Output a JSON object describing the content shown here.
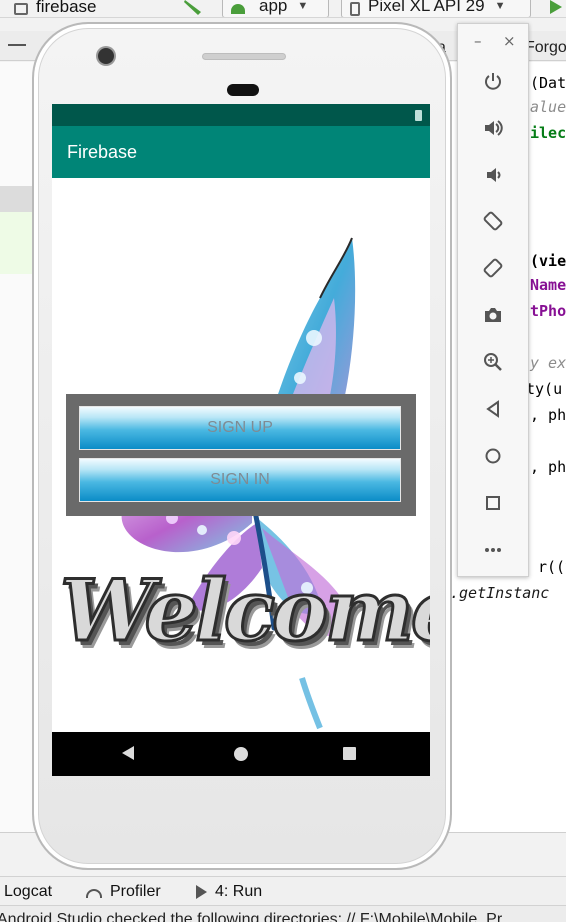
{
  "toolbar": {
    "project": "firebase",
    "run_config": "app",
    "device": "Pixel XL API 29"
  },
  "editor": {
    "tabs": [
      "va",
      "Forgo"
    ],
    "code_lines": [
      {
        "text": "(Dat",
        "style": "plain"
      },
      {
        "text": "alue",
        "style": "italic"
      },
      {
        "text": "ilec",
        "style": "green"
      },
      {
        "text": "(vie",
        "style": "bold"
      },
      {
        "text": "Name",
        "style": "purple"
      },
      {
        "text": "tPho",
        "style": "purple"
      },
      {
        "text": "y ex",
        "style": "italic"
      },
      {
        "text": "ty(u",
        "style": "plain"
      },
      {
        "text": ", ph",
        "style": "plain"
      },
      {
        "text": ", ph",
        "style": "plain"
      },
      {
        "text": "r((v",
        "style": "plain"
      },
      {
        "text": ".getInstanc",
        "style": "italic-dark"
      }
    ]
  },
  "bottom_tabs": {
    "logcat": "Logcat",
    "profiler": "Profiler",
    "run": "4: Run"
  },
  "status_message": "Android Studio checked the following directories: // F:\\Mobile\\Mobile_Pr",
  "emulator": {
    "app_title": "Firebase",
    "sign_up_label": "SIGN UP",
    "sign_in_label": "SIGN IN",
    "welcome_art_text": "Welcome",
    "colors": {
      "status_bar": "#00574b",
      "app_bar": "#008577",
      "button_top": "#f2fbff",
      "button_bottom": "#0b8cc7",
      "button_text": "#7f8b93",
      "panel": "#6a6a6a"
    },
    "nav_icons": [
      "back-icon",
      "home-icon",
      "recents-icon"
    ]
  },
  "emulator_toolbar": {
    "window_icons": [
      "minimize-icon",
      "close-icon"
    ],
    "icons": [
      "power-icon",
      "volume-up-icon",
      "volume-down-icon",
      "rotate-left-icon",
      "rotate-right-icon",
      "camera-icon",
      "zoom-icon",
      "back-icon",
      "home-icon",
      "overview-icon",
      "more-icon"
    ]
  }
}
